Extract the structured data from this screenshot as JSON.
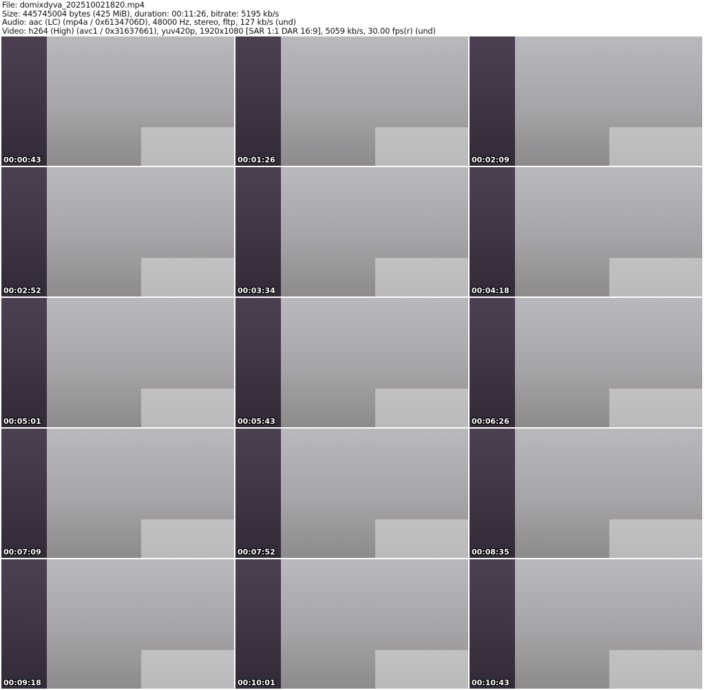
{
  "header": {
    "file": "File: domixdyva_202510021820.mp4",
    "size": "Size: 445745004 bytes (425 MiB), duration: 00:11:26, bitrate: 5195 kb/s",
    "audio": "Audio: aac (LC) (mp4a / 0x6134706D), 48000 Hz, stereo, fltp, 127 kb/s (und)",
    "video": "Video: h264 (High) (avc1 / 0x31637661), yuv420p, 1920x1080 [SAR 1:1 DAR 16:9], 5059 kb/s, 30.00 fps(r) (und)"
  },
  "thumbnails": [
    {
      "time": "00:00:43"
    },
    {
      "time": "00:01:26"
    },
    {
      "time": "00:02:09"
    },
    {
      "time": "00:02:52"
    },
    {
      "time": "00:03:34"
    },
    {
      "time": "00:04:18"
    },
    {
      "time": "00:05:01"
    },
    {
      "time": "00:05:43"
    },
    {
      "time": "00:06:26"
    },
    {
      "time": "00:07:09"
    },
    {
      "time": "00:07:52"
    },
    {
      "time": "00:08:35"
    },
    {
      "time": "00:09:18"
    },
    {
      "time": "00:10:01"
    },
    {
      "time": "00:10:43"
    }
  ]
}
